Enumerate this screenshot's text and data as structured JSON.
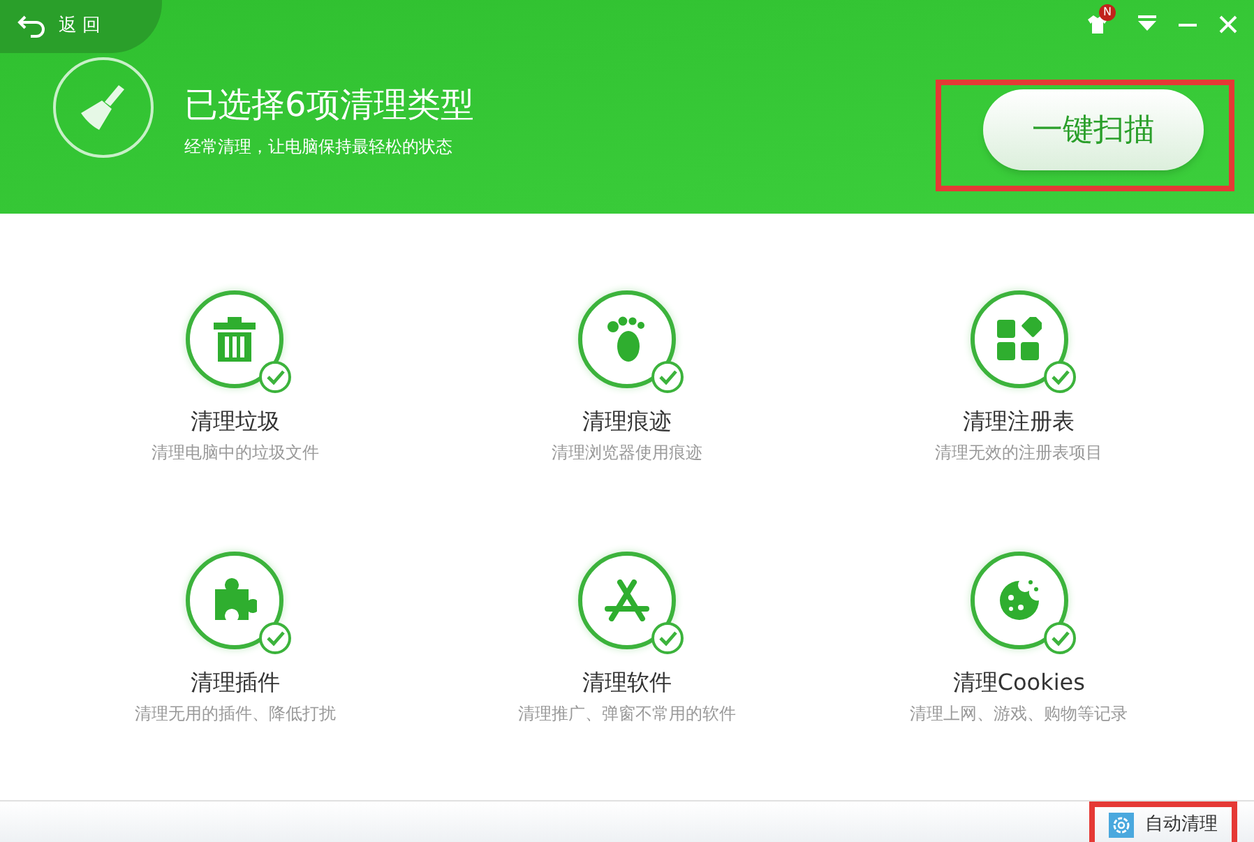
{
  "back_button": {
    "label": "返 回"
  },
  "window_controls": {
    "skin_badge": "N"
  },
  "header": {
    "title": "已选择6项清理类型",
    "subtitle": "经常清理，让电脑保持最轻松的状态",
    "scan_button": "一键扫描"
  },
  "categories": [
    {
      "kind": "trash",
      "title": "清理垃圾",
      "description": "清理电脑中的垃圾文件",
      "checked": true
    },
    {
      "kind": "footprint",
      "title": "清理痕迹",
      "description": "清理浏览器使用痕迹",
      "checked": true
    },
    {
      "kind": "registry",
      "title": "清理注册表",
      "description": "清理无效的注册表项目",
      "checked": true
    },
    {
      "kind": "plugin",
      "title": "清理插件",
      "description": "清理无用的插件、降低打扰",
      "checked": true
    },
    {
      "kind": "software",
      "title": "清理软件",
      "description": "清理推广、弹窗不常用的软件",
      "checked": true
    },
    {
      "kind": "cookie",
      "title": "清理Cookies",
      "description": "清理上网、游戏、购物等记录",
      "checked": true
    }
  ],
  "footer": {
    "auto_clean": "自动清理"
  }
}
